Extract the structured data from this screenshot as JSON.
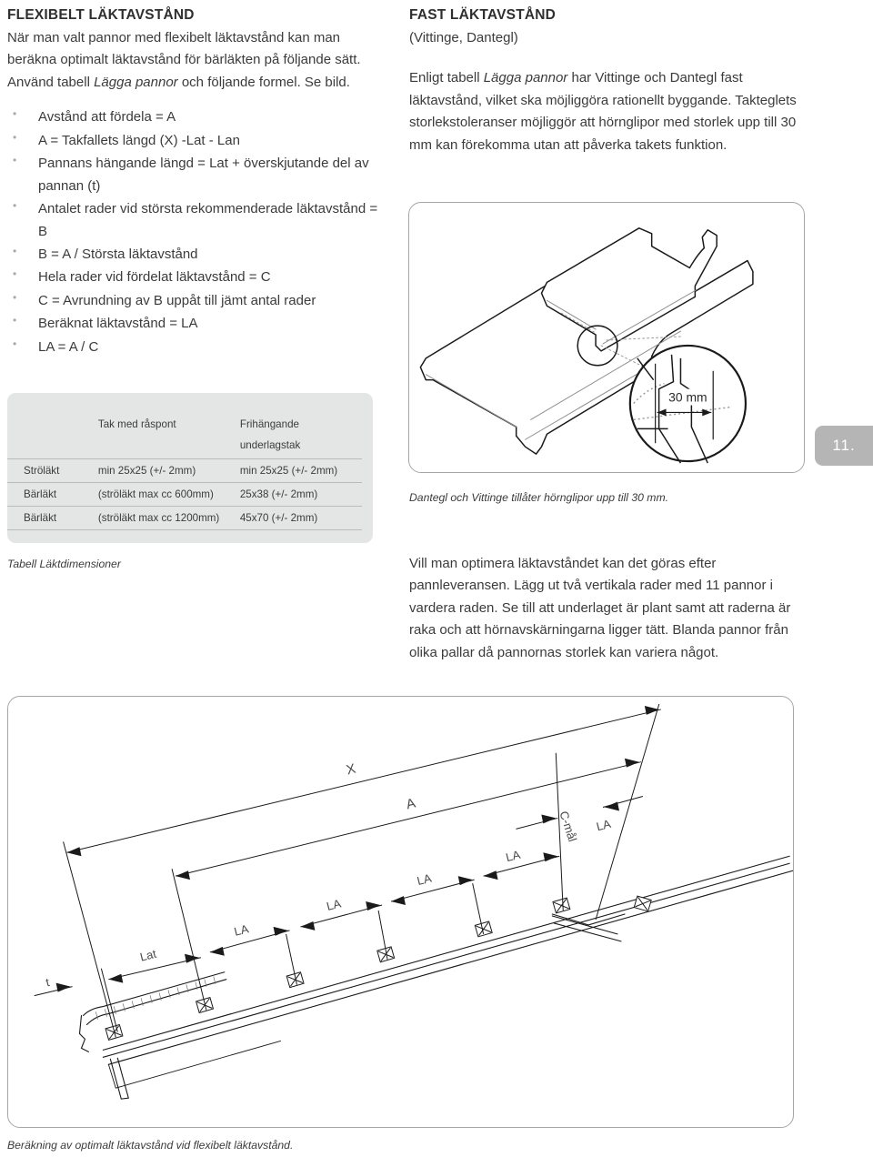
{
  "left_column": {
    "heading": "FLEXIBELT LÄKTAVSTÅND",
    "intro_line1": "När man valt pannor med flexibelt läktavstånd kan man",
    "intro_line2": "beräkna optimalt läktavstånd för bärläkten på följande sätt.",
    "intro_line3_a": "Använd tabell ",
    "intro_line3_it": "Lägga pannor",
    "intro_line3_b": " och följande formel. Se bild.",
    "bullets": [
      "Avstånd att fördela = A",
      "A = Takfallets längd (X) -Lat - Lan",
      "Pannans hängande längd = Lat + överskjutande del av pannan (t)",
      "Antalet rader vid största rekommenderade läktavstånd = B",
      "B = A / Största läktavstånd",
      "Hela rader vid fördelat läktavstånd = C",
      "C = Avrundning av B uppåt till jämt antal rader",
      "Beräknat läktavstånd = LA",
      "LA = A / C"
    ]
  },
  "table": {
    "caption": "Tabell Läktdimensioner",
    "headers": [
      "",
      "Tak med råspont",
      "Frihängande underlagstak"
    ],
    "header_col2_line1": "Frihängande",
    "header_col2_line2": "underlagstak",
    "rows": [
      [
        "Ströläkt",
        "min 25x25 (+/- 2mm)",
        "min 25x25 (+/- 2mm)"
      ],
      [
        "Bärläkt",
        "(ströläkt max cc 600mm)",
        "25x38 (+/- 2mm)"
      ],
      [
        "Bärläkt",
        "(ströläkt max cc 1200mm)",
        "45x70 (+/- 2mm)"
      ]
    ]
  },
  "right_column": {
    "heading": "FAST LÄKTAVSTÅND",
    "subheading": "(Vittinge, Dantegl)",
    "para1_a": "Enligt tabell ",
    "para1_it": "Lägga pannor",
    "para1_b": " har Vittinge och Dantegl fast läktavstånd, vilket ska möjliggöra rationellt byggande. Takteglets storlekstoleranser möjliggör att hörnglipor med storlek upp till 30 mm kan förekomma utan att påverka takets funktion.",
    "tile_caption": "Dantegl och Vittinge tillåter hörnglipor upp till 30 mm.",
    "para2": "Vill man optimera läktavståndet kan det göras efter pannleveransen. Lägg ut två vertikala rader med 11 pannor i vardera raden. Se till att underlaget är plant samt att raderna är raka och att hörnavskärningarna ligger tätt. Blanda pannor från olika pallar då pannornas storlek kan variera något."
  },
  "tile_illustration": {
    "dimension_label": "30 mm"
  },
  "big_illustration": {
    "caption": "Beräkning av optimalt läktavstånd vid flexibelt läktavstånd.",
    "labels": {
      "x": "X",
      "a": "A",
      "t": "t",
      "lat": "Lat",
      "la": "LA",
      "cmal": "C-mål"
    }
  },
  "page_tab": {
    "number": "11."
  },
  "colors": {
    "text": "#3b3b3b",
    "panel_grey": "#e4e6e6",
    "rule_grey": "#b9bcbc",
    "frame_grey": "#a6a6a6",
    "tab_grey": "#b5b5b5"
  }
}
